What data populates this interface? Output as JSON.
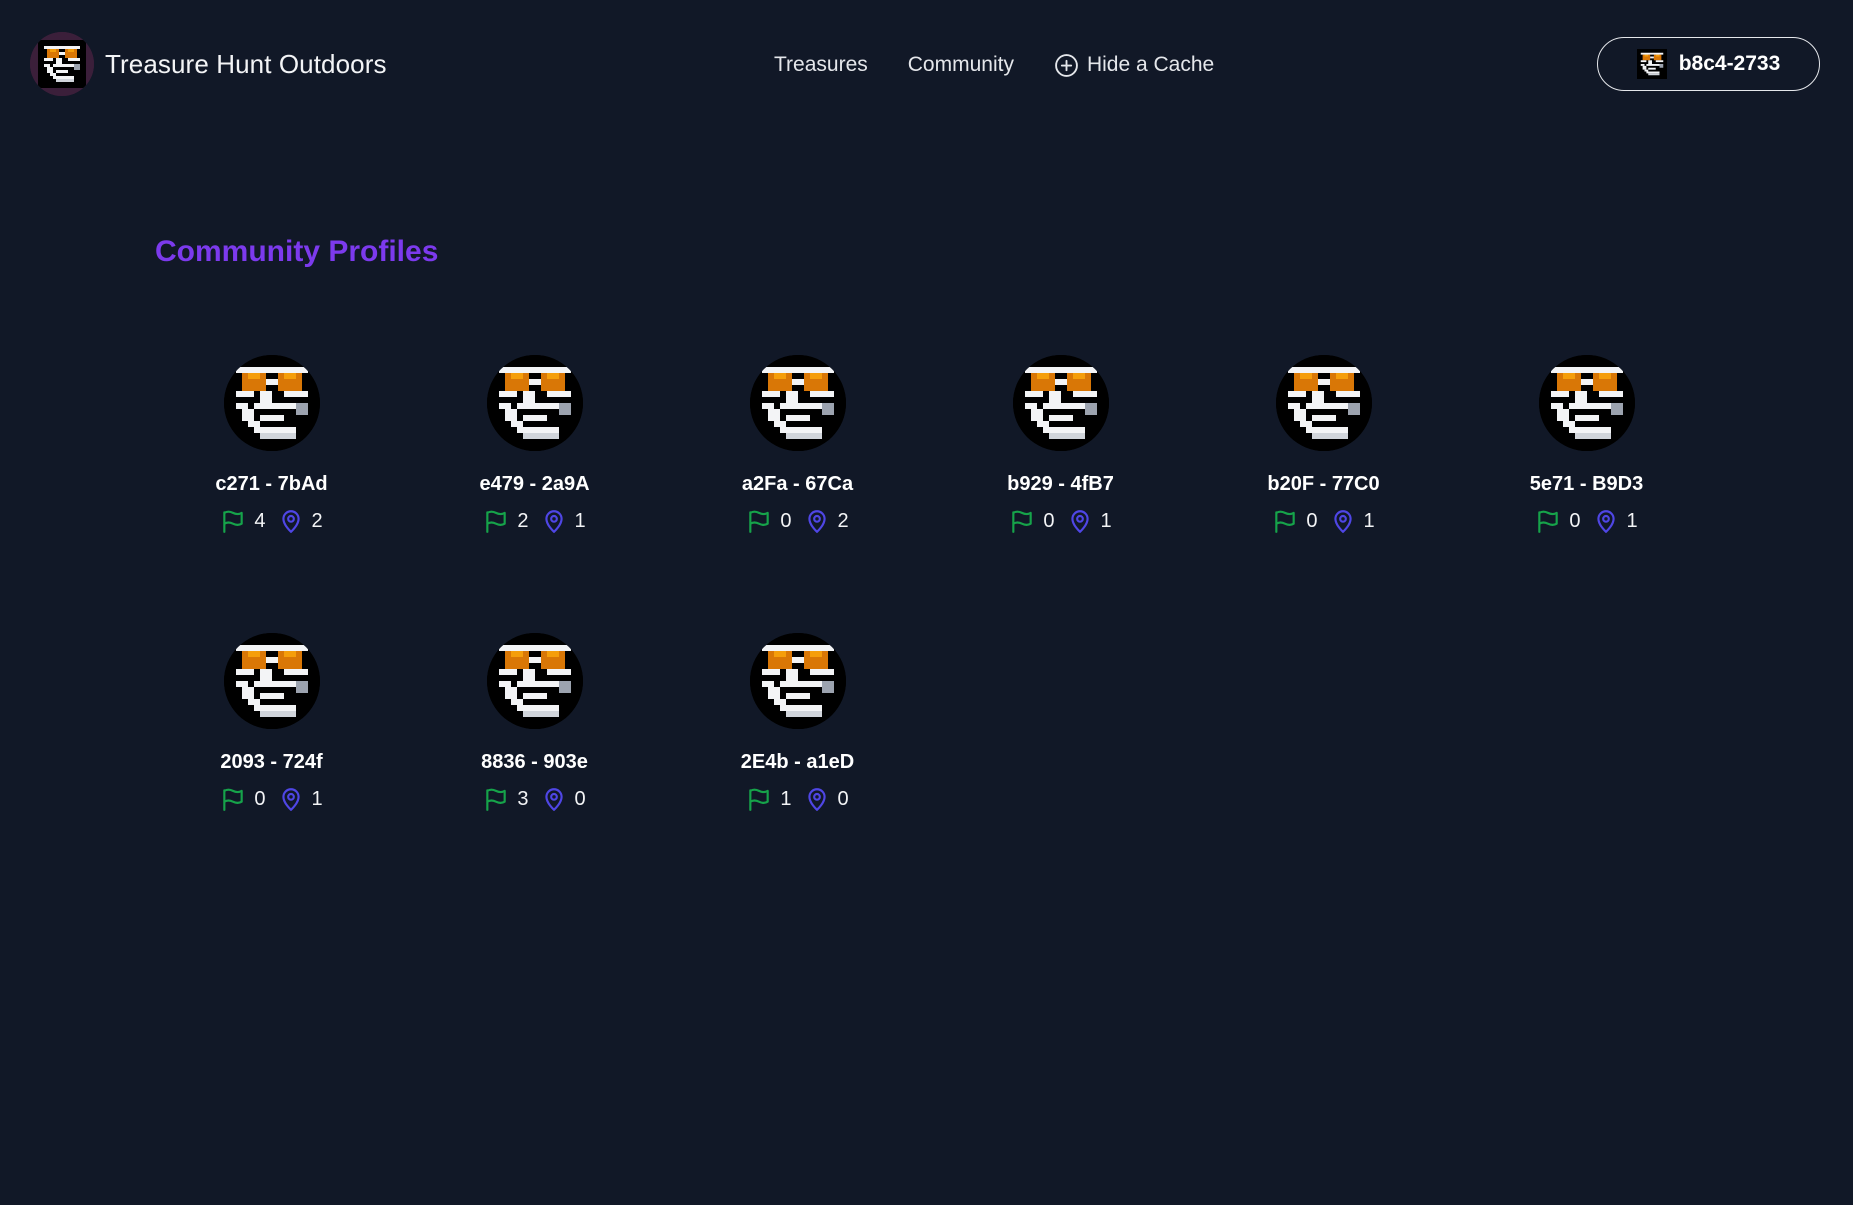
{
  "app": {
    "title": "Treasure Hunt Outdoors"
  },
  "nav": {
    "treasures": "Treasures",
    "community": "Community",
    "hide_cache": "Hide a Cache"
  },
  "user": {
    "label": "b8c4-2733"
  },
  "page": {
    "title": "Community Profiles"
  },
  "colors": {
    "background": "#111827",
    "accent_purple": "#7c3aed",
    "flag_green": "#16a34a",
    "pin_indigo": "#4f46e5"
  },
  "icons": {
    "found": "flag-icon",
    "hidden": "map-pin-icon"
  },
  "profiles": [
    {
      "name": "c271 - 7bAd",
      "found": "4",
      "hidden": "2"
    },
    {
      "name": "e479 - 2a9A",
      "found": "2",
      "hidden": "1"
    },
    {
      "name": "a2Fa - 67Ca",
      "found": "0",
      "hidden": "2"
    },
    {
      "name": "b929 - 4fB7",
      "found": "0",
      "hidden": "1"
    },
    {
      "name": "b20F - 77C0",
      "found": "0",
      "hidden": "1"
    },
    {
      "name": "5e71 - B9D3",
      "found": "0",
      "hidden": "1"
    },
    {
      "name": "2093 - 724f",
      "found": "0",
      "hidden": "1"
    },
    {
      "name": "8836 - 903e",
      "found": "3",
      "hidden": "0"
    },
    {
      "name": "2E4b - a1eD",
      "found": "1",
      "hidden": "0"
    }
  ]
}
